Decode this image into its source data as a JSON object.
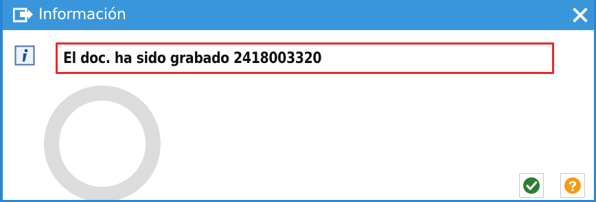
{
  "dialog": {
    "title": "Información",
    "message": "El doc. ha sido grabado 2418003320"
  },
  "icons": {
    "title": "dialog-window-icon",
    "close": "close-icon",
    "info": "info-icon",
    "confirm": "checkmark-icon",
    "help": "question-icon"
  },
  "colors": {
    "titlebar": "#3a96db",
    "highlight_border": "#e52a2a",
    "confirm": "#2e7d32",
    "help": "#f39c12"
  }
}
